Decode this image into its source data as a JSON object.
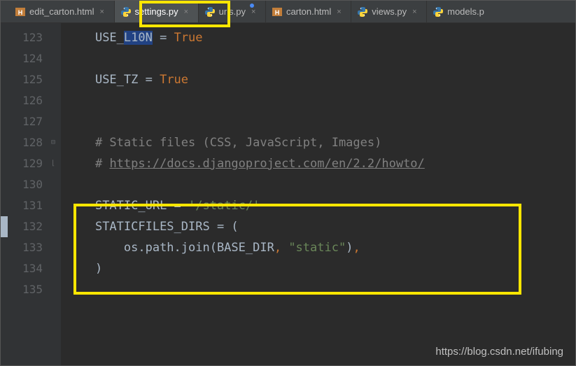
{
  "tabs": [
    {
      "label": "edit_carton.html",
      "icon": "html"
    },
    {
      "label": "settings.py",
      "icon": "python"
    },
    {
      "label": "urls.py",
      "icon": "python"
    },
    {
      "label": "carton.html",
      "icon": "html"
    },
    {
      "label": "views.py",
      "icon": "python"
    },
    {
      "label": "models.p",
      "icon": "python"
    }
  ],
  "gutter": {
    "start": 123,
    "end": 135
  },
  "code": {
    "l123_a": "USE_",
    "l123_b": "L10N",
    "l123_c": " = ",
    "l123_d": "True",
    "l125_a": "USE_TZ = ",
    "l125_b": "True",
    "l128": "# Static files (CSS, JavaScript, Images)",
    "l129_a": "# ",
    "l129_b": "https://docs.djangoproject.com/en/2.2/howto/",
    "l131_a": "STATIC_URL = ",
    "l131_b": "'/static/'",
    "l132": "STATICFILES_DIRS = (",
    "l133_a": "    os.path.join(BASE_DIR",
    "l133_b": ", ",
    "l133_c": "\"static\"",
    "l133_d": ")",
    "l133_e": ",",
    "l134": ")"
  },
  "watermark": "https://blog.csdn.net/ifubing"
}
